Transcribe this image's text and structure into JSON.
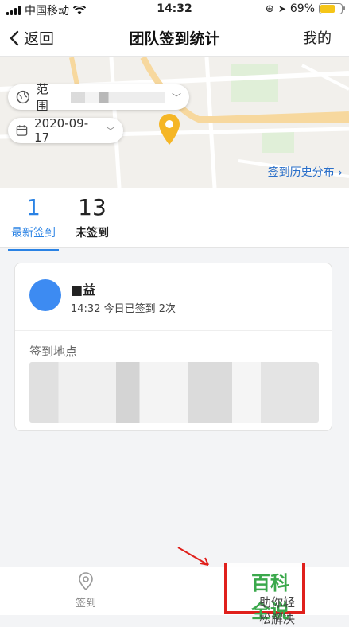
{
  "status_bar": {
    "carrier": "中国移动",
    "time": "14:32",
    "battery": "69%",
    "battery_level": 0.69
  },
  "nav": {
    "back_label": "返回",
    "title": "团队签到统计",
    "right_label": "我的"
  },
  "map": {
    "range_label": "范围",
    "date": "2020-09-17",
    "history_label": "签到历史分布"
  },
  "stats": {
    "signed": {
      "value": "1",
      "label": "最新签到"
    },
    "unsigned": {
      "value": "13",
      "label": "未签到"
    }
  },
  "record": {
    "name": "■益",
    "sign_info": "14:32 今日已签到 2次",
    "location_label": "签到地点"
  },
  "tabbar": {
    "sign_label": "签到"
  },
  "watermark": {
    "title": "百科全说",
    "subtitle": "助你轻松解决"
  },
  "colors": {
    "accent": "#2a82e4",
    "watermark_green": "#3aa84b",
    "watermark_red": "#e0201c"
  }
}
